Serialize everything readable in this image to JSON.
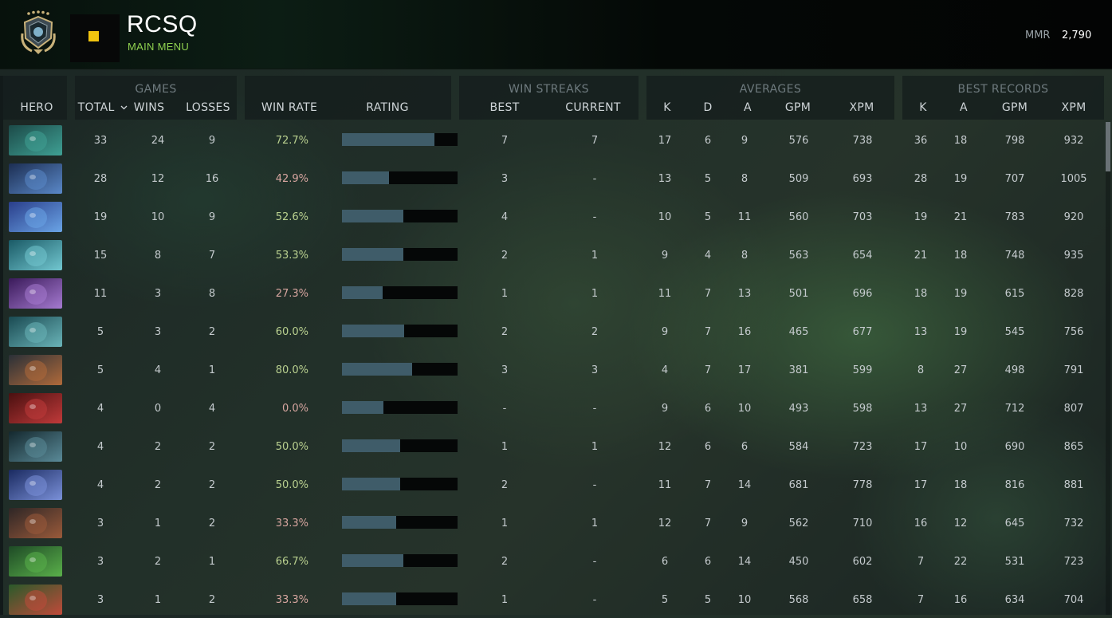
{
  "header": {
    "title": "RCSQ",
    "subtitle": "MAIN MENU",
    "mmr_label": "MMR",
    "mmr_value": "2,790"
  },
  "groups": {
    "games": "GAMES",
    "win_streaks": "WIN STREAKS",
    "averages": "AVERAGES",
    "best_records": "BEST RECORDS"
  },
  "columns": {
    "hero": "HERO",
    "total": "TOTAL",
    "wins": "WINS",
    "losses": "LOSSES",
    "win_rate": "WIN RATE",
    "rating": "RATING",
    "best": "BEST",
    "current": "CURRENT",
    "avg_k": "K",
    "avg_d": "D",
    "avg_a": "A",
    "avg_gpm": "GPM",
    "avg_xpm": "XPM",
    "best_k": "K",
    "best_a": "A",
    "best_gpm": "GPM",
    "best_xpm": "XPM"
  },
  "sort_indicator": "chevron-down-icon",
  "colors": {
    "accent": "#8fd14f",
    "rank_dot": "#f1c40f",
    "rating_fill": "#3f5c69",
    "winrate_high": "#b9d08f",
    "winrate_low": "#d8a6a0"
  },
  "rows": [
    {
      "total": "33",
      "wins": "24",
      "losses": "9",
      "win_rate": "72.7%",
      "rating": 0.8,
      "best": "7",
      "current": "7",
      "k": "17",
      "d": "6",
      "a": "9",
      "gpm": "576",
      "xpm": "738",
      "bk": "36",
      "ba": "18",
      "bgpm": "798",
      "bxpm": "932",
      "hero_color": [
        "#1c4a48",
        "#3fa094"
      ]
    },
    {
      "total": "28",
      "wins": "12",
      "losses": "16",
      "win_rate": "42.9%",
      "rating": 0.41,
      "best": "3",
      "current": "-",
      "k": "13",
      "d": "5",
      "a": "8",
      "gpm": "509",
      "xpm": "693",
      "bk": "28",
      "ba": "19",
      "bgpm": "707",
      "bxpm": "1005",
      "hero_color": [
        "#1c2e52",
        "#5a88c8"
      ]
    },
    {
      "total": "19",
      "wins": "10",
      "losses": "9",
      "win_rate": "52.6%",
      "rating": 0.53,
      "best": "4",
      "current": "-",
      "k": "10",
      "d": "5",
      "a": "11",
      "gpm": "560",
      "xpm": "703",
      "bk": "19",
      "ba": "21",
      "bgpm": "783",
      "bxpm": "920",
      "hero_color": [
        "#2a3e8a",
        "#6aa4e6"
      ]
    },
    {
      "total": "15",
      "wins": "8",
      "losses": "7",
      "win_rate": "53.3%",
      "rating": 0.53,
      "best": "2",
      "current": "1",
      "k": "9",
      "d": "4",
      "a": "8",
      "gpm": "563",
      "xpm": "654",
      "bk": "21",
      "ba": "18",
      "bgpm": "748",
      "bxpm": "935",
      "hero_color": [
        "#1a5a66",
        "#72c7d0"
      ]
    },
    {
      "total": "11",
      "wins": "3",
      "losses": "8",
      "win_rate": "27.3%",
      "rating": 0.35,
      "best": "1",
      "current": "1",
      "k": "11",
      "d": "7",
      "a": "13",
      "gpm": "501",
      "xpm": "696",
      "bk": "18",
      "ba": "19",
      "bgpm": "615",
      "bxpm": "828",
      "hero_color": [
        "#3a1a5a",
        "#a57ad0"
      ]
    },
    {
      "total": "5",
      "wins": "3",
      "losses": "2",
      "win_rate": "60.0%",
      "rating": 0.54,
      "best": "2",
      "current": "2",
      "k": "9",
      "d": "7",
      "a": "16",
      "gpm": "465",
      "xpm": "677",
      "bk": "13",
      "ba": "19",
      "bgpm": "545",
      "bxpm": "756",
      "hero_color": [
        "#1a4a52",
        "#6ab4b8"
      ]
    },
    {
      "total": "5",
      "wins": "4",
      "losses": "1",
      "win_rate": "80.0%",
      "rating": 0.61,
      "best": "3",
      "current": "3",
      "k": "4",
      "d": "7",
      "a": "17",
      "gpm": "381",
      "xpm": "599",
      "bk": "8",
      "ba": "27",
      "bgpm": "498",
      "bxpm": "791",
      "hero_color": [
        "#2a3038",
        "#b06a3a"
      ]
    },
    {
      "total": "4",
      "wins": "0",
      "losses": "4",
      "win_rate": "0.0%",
      "rating": 0.36,
      "best": "-",
      "current": "-",
      "k": "9",
      "d": "6",
      "a": "10",
      "gpm": "493",
      "xpm": "598",
      "bk": "13",
      "ba": "27",
      "bgpm": "712",
      "bxpm": "807",
      "hero_color": [
        "#4a1010",
        "#c03a3a"
      ]
    },
    {
      "total": "4",
      "wins": "2",
      "losses": "2",
      "win_rate": "50.0%",
      "rating": 0.5,
      "best": "1",
      "current": "1",
      "k": "12",
      "d": "6",
      "a": "6",
      "gpm": "584",
      "xpm": "723",
      "bk": "17",
      "ba": "10",
      "bgpm": "690",
      "bxpm": "865",
      "hero_color": [
        "#14282e",
        "#5a8a98"
      ]
    },
    {
      "total": "4",
      "wins": "2",
      "losses": "2",
      "win_rate": "50.0%",
      "rating": 0.5,
      "best": "2",
      "current": "-",
      "k": "11",
      "d": "7",
      "a": "14",
      "gpm": "681",
      "xpm": "778",
      "bk": "17",
      "ba": "18",
      "bgpm": "816",
      "bxpm": "881",
      "hero_color": [
        "#1a2a60",
        "#7a90d8"
      ]
    },
    {
      "total": "3",
      "wins": "1",
      "losses": "2",
      "win_rate": "33.3%",
      "rating": 0.47,
      "best": "1",
      "current": "1",
      "k": "12",
      "d": "7",
      "a": "9",
      "gpm": "562",
      "xpm": "710",
      "bk": "16",
      "ba": "12",
      "bgpm": "645",
      "bxpm": "732",
      "hero_color": [
        "#2e2626",
        "#9a5a3a"
      ]
    },
    {
      "total": "3",
      "wins": "2",
      "losses": "1",
      "win_rate": "66.7%",
      "rating": 0.53,
      "best": "2",
      "current": "-",
      "k": "6",
      "d": "6",
      "a": "14",
      "gpm": "450",
      "xpm": "602",
      "bk": "7",
      "ba": "22",
      "bgpm": "531",
      "bxpm": "723",
      "hero_color": [
        "#1e4a26",
        "#5ab04a"
      ]
    },
    {
      "total": "3",
      "wins": "1",
      "losses": "2",
      "win_rate": "33.3%",
      "rating": 0.47,
      "best": "1",
      "current": "-",
      "k": "5",
      "d": "5",
      "a": "10",
      "gpm": "568",
      "xpm": "658",
      "bk": "7",
      "ba": "16",
      "bgpm": "634",
      "bxpm": "704",
      "hero_color": [
        "#2a5a2a",
        "#c04a3a"
      ]
    }
  ]
}
